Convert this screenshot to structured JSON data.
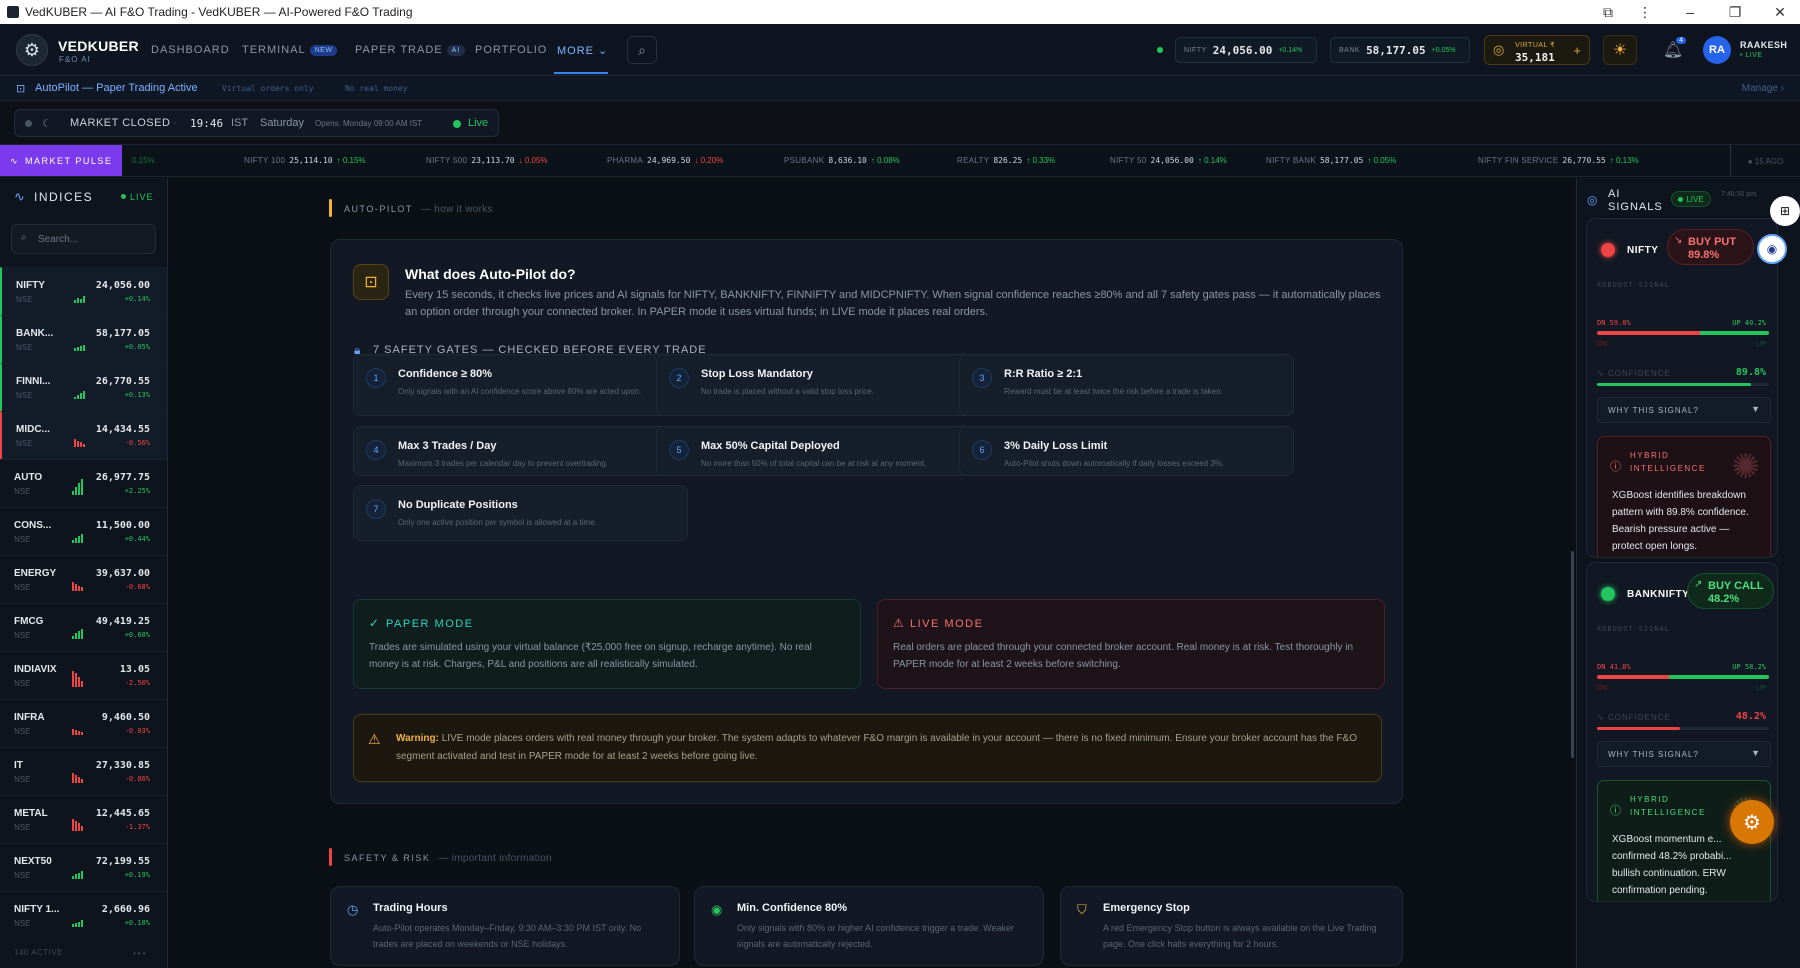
{
  "window": {
    "title": "VedKUBER — AI F&O Trading - VedKUBER — AI-Powered F&O Trading"
  },
  "nav": {
    "brand": "VEDKUBER",
    "brand_sub": "F&O AI",
    "items": [
      {
        "label": "DASHBOARD"
      },
      {
        "label": "TERMINAL",
        "badge": "NEW"
      },
      {
        "label": "PAPER TRADE",
        "badge": "AI"
      },
      {
        "label": "PORTFOLIO"
      },
      {
        "label": "MORE ⌄",
        "active": true
      }
    ],
    "quotes": [
      {
        "label": "NIFTY",
        "value": "24,056.00",
        "change": "+0.14%"
      },
      {
        "label": "BANK",
        "value": "58,177.05",
        "change": "+0.05%"
      }
    ],
    "virtual": {
      "label": "VIRTUAL ₹",
      "value": "35,181",
      "plus": "+"
    },
    "notifications_count": "4",
    "user": {
      "initials": "RA",
      "name": "RAAKESH",
      "status": "• LIVE"
    }
  },
  "autopilot_banner": {
    "title": "AutoPilot — Paper Trading Active",
    "tag1": "Virtual orders only",
    "tag2": "No real money",
    "manage": "Manage ›"
  },
  "market_status": {
    "state": "MARKET CLOSED",
    "separator": "·",
    "time": "19:46",
    "zone": "IST",
    "day": "Saturday",
    "opens": "Opens: Monday 09:00 AM IST",
    "live": "Live"
  },
  "ticker": {
    "tab": "MARKET PULSE",
    "items": [
      {
        "name": "NIFTY 100",
        "value": "25,114.10",
        "change": "↑ 0.15%",
        "dir": "up"
      },
      {
        "name": "NIFTY 500",
        "value": "23,113.70",
        "change": "↓ 0.05%",
        "dir": "dn"
      },
      {
        "name": "PHARMA",
        "value": "24,969.50",
        "change": "↓ 0.20%",
        "dir": "dn"
      },
      {
        "name": "PSUBANK",
        "value": "8,636.10",
        "change": "↑ 0.08%",
        "dir": "up"
      },
      {
        "name": "REALTY",
        "value": "826.25",
        "change": "↑ 0.33%",
        "dir": "up"
      },
      {
        "name": "NIFTY 50",
        "value": "24,056.00",
        "change": "↑ 0.14%",
        "dir": "up"
      },
      {
        "name": "NIFTY BANK",
        "value": "58,177.05",
        "change": "↑ 0.05%",
        "dir": "up"
      },
      {
        "name": "NIFTY FIN SERVICE",
        "value": "26,770.55",
        "change": "↑ 0.13%",
        "dir": "up"
      }
    ],
    "ago": "● 15 AGO"
  },
  "sidebar": {
    "title": "INDICES",
    "live": "LIVE",
    "search_placeholder": "Search...",
    "indices": [
      {
        "name": "NIFTY",
        "exchange": "NSE",
        "price": "24,056.00",
        "change": "+0.14%",
        "dir": "up",
        "bars": [
          3,
          5,
          4,
          7
        ]
      },
      {
        "name": "BANK...",
        "exchange": "NSE",
        "price": "58,177.05",
        "change": "+0.05%",
        "dir": "up",
        "bars": [
          3,
          4,
          5,
          6
        ]
      },
      {
        "name": "FINNI...",
        "exchange": "NSE",
        "price": "26,770.55",
        "change": "+0.13%",
        "dir": "up",
        "bars": [
          2,
          4,
          6,
          8
        ]
      },
      {
        "name": "MIDC...",
        "exchange": "NSE",
        "price": "14,434.55",
        "change": "-0.56%",
        "dir": "dn",
        "bars": [
          8,
          6,
          5,
          3
        ]
      },
      {
        "name": "AUTO",
        "exchange": "NSE",
        "price": "26,977.75",
        "change": "+2.25%",
        "dir": "up",
        "bars": [
          4,
          8,
          12,
          16
        ]
      },
      {
        "name": "CONS...",
        "exchange": "NSE",
        "price": "11,500.00",
        "change": "+0.44%",
        "dir": "up",
        "bars": [
          3,
          5,
          7,
          9
        ]
      },
      {
        "name": "ENERGY",
        "exchange": "NSE",
        "price": "39,637.00",
        "change": "-0.68%",
        "dir": "dn",
        "bars": [
          9,
          7,
          5,
          4
        ]
      },
      {
        "name": "FMCG",
        "exchange": "NSE",
        "price": "49,419.25",
        "change": "+0.60%",
        "dir": "up",
        "bars": [
          3,
          6,
          8,
          10
        ]
      },
      {
        "name": "INDIAVIX",
        "exchange": "NSE",
        "price": "13.05",
        "change": "-2.50%",
        "dir": "dn",
        "bars": [
          16,
          14,
          10,
          6
        ]
      },
      {
        "name": "INFRA",
        "exchange": "NSE",
        "price": "9,460.50",
        "change": "-0.03%",
        "dir": "dn",
        "bars": [
          6,
          5,
          4,
          3
        ]
      },
      {
        "name": "IT",
        "exchange": "NSE",
        "price": "27,330.85",
        "change": "-0.86%",
        "dir": "dn",
        "bars": [
          10,
          8,
          6,
          4
        ]
      },
      {
        "name": "METAL",
        "exchange": "NSE",
        "price": "12,445.65",
        "change": "-1.37%",
        "dir": "dn",
        "bars": [
          12,
          10,
          8,
          5
        ]
      },
      {
        "name": "NEXT50",
        "exchange": "NSE",
        "price": "72,199.55",
        "change": "+0.19%",
        "dir": "up",
        "bars": [
          3,
          5,
          6,
          8
        ]
      },
      {
        "name": "NIFTY 1...",
        "exchange": "NSE",
        "price": "2,660.96",
        "change": "+0.10%",
        "dir": "up",
        "bars": [
          3,
          4,
          5,
          7
        ]
      }
    ],
    "footer": "140 ACTIVE",
    "footer_dots": "•••"
  },
  "autopilot": {
    "section_title": "AUTO-PILOT",
    "section_sub": "— how it works",
    "card_title": "What does Auto-Pilot do?",
    "card_desc": "Every 15 seconds, it checks live prices and AI signals for NIFTY, BANKNIFTY, FINNIFTY and MIDCPNIFTY. When signal confidence reaches ≥80% and all 7 safety gates pass — it automatically places an option order through your connected broker. In PAPER mode it uses virtual funds; in LIVE mode it places real orders.",
    "gates_title": "7 SAFETY GATES — CHECKED BEFORE EVERY TRADE",
    "gates": [
      {
        "num": "1",
        "title": "Confidence ≥ 80%",
        "desc": "Only signals with an AI confidence score above 80% are acted upon."
      },
      {
        "num": "2",
        "title": "Stop Loss Mandatory",
        "desc": "No trade is placed without a valid stop loss price."
      },
      {
        "num": "3",
        "title": "R:R Ratio ≥ 2:1",
        "desc": "Reward must be at least twice the risk before a trade is taken."
      },
      {
        "num": "4",
        "title": "Max 3 Trades / Day",
        "desc": "Maximum 3 trades per calendar day to prevent overtrading."
      },
      {
        "num": "5",
        "title": "Max 50% Capital Deployed",
        "desc": "No more than 50% of total capital can be at risk at any moment."
      },
      {
        "num": "6",
        "title": "3% Daily Loss Limit",
        "desc": "Auto-Pilot shuts down automatically if daily losses exceed 3%."
      },
      {
        "num": "7",
        "title": "No Duplicate Positions",
        "desc": "Only one active position per symbol is allowed at a time."
      }
    ],
    "paper_mode": {
      "title": "PAPER MODE",
      "desc": "Trades are simulated using your virtual balance (₹25,000 free on signup, recharge anytime). No real money is at risk. Charges, P&L and positions are all realistically simulated."
    },
    "live_mode": {
      "title": "LIVE MODE",
      "desc": "Real orders are placed through your connected broker account. Real money is at risk. Test thoroughly in PAPER mode for at least 2 weeks before switching."
    },
    "warning_label": "Warning:",
    "warning_text": " LIVE mode places orders with real money through your broker. The system adapts to whatever F&O margin is available in your account — there is no fixed minimum. Ensure your broker account has the F&O segment activated and test in PAPER mode for at least 2 weeks before going live."
  },
  "safety": {
    "section_title": "SAFETY & RISK",
    "section_sub": "— important information",
    "cards": [
      {
        "title": "Trading Hours",
        "desc": "Auto-Pilot operates Monday–Friday, 9:30 AM–3:30 PM IST only. No trades are placed on weekends or NSE holidays."
      },
      {
        "title": "Min. Confidence 80%",
        "desc": "Only signals with 80% or higher AI confidence trigger a trade. Weaker signals are automatically rejected."
      },
      {
        "title": "Emergency Stop",
        "desc": "A red Emergency Stop button is always available on the Live Trading page. One click halts everything for 2 hours."
      }
    ]
  },
  "signals": {
    "title": "AI SIGNALS",
    "live": "LIVE",
    "time": "7:46:50 pm",
    "cards": [
      {
        "symbol": "NIFTY",
        "action": "BUY PUT",
        "action_conf": "89.8%",
        "action_arrow": "↘",
        "xg_label": "XGBOOST SIGNAL",
        "dn": "DN 59.8%",
        "up": "UP 40.2%",
        "dn_frac": 0.598,
        "up_frac": 0.402,
        "dn_lbl": "DN",
        "up_lbl": "UP",
        "conf_label": "CONFIDENCE",
        "conf_value": "89.8%",
        "conf_frac": 0.898,
        "why": "WHY THIS SIGNAL?",
        "hybrid_title": "HYBRID INTELLIGENCE",
        "hybrid_desc": "XGBoost identifies breakdown pattern with 89.8% confidence. Bearish pressure active — protect open longs."
      },
      {
        "symbol": "BANKNIFTY",
        "action": "BUY CALL",
        "action_conf": "48.2%",
        "action_arrow": "↗",
        "xg_label": "XGBOOST SIGNAL",
        "dn": "DN 41.8%",
        "up": "UP 58.2%",
        "dn_frac": 0.418,
        "up_frac": 0.582,
        "dn_lbl": "DN",
        "up_lbl": "UP",
        "conf_label": "CONFIDENCE",
        "conf_value": "48.2%",
        "conf_frac": 0.482,
        "why": "WHY THIS SIGNAL?",
        "hybrid_title": "HYBRID INTELLIGENCE",
        "hybrid_desc": "XGBoost momentum e... confirmed 48.2% probabi... bullish continuation. ERW confirmation pending."
      }
    ]
  }
}
